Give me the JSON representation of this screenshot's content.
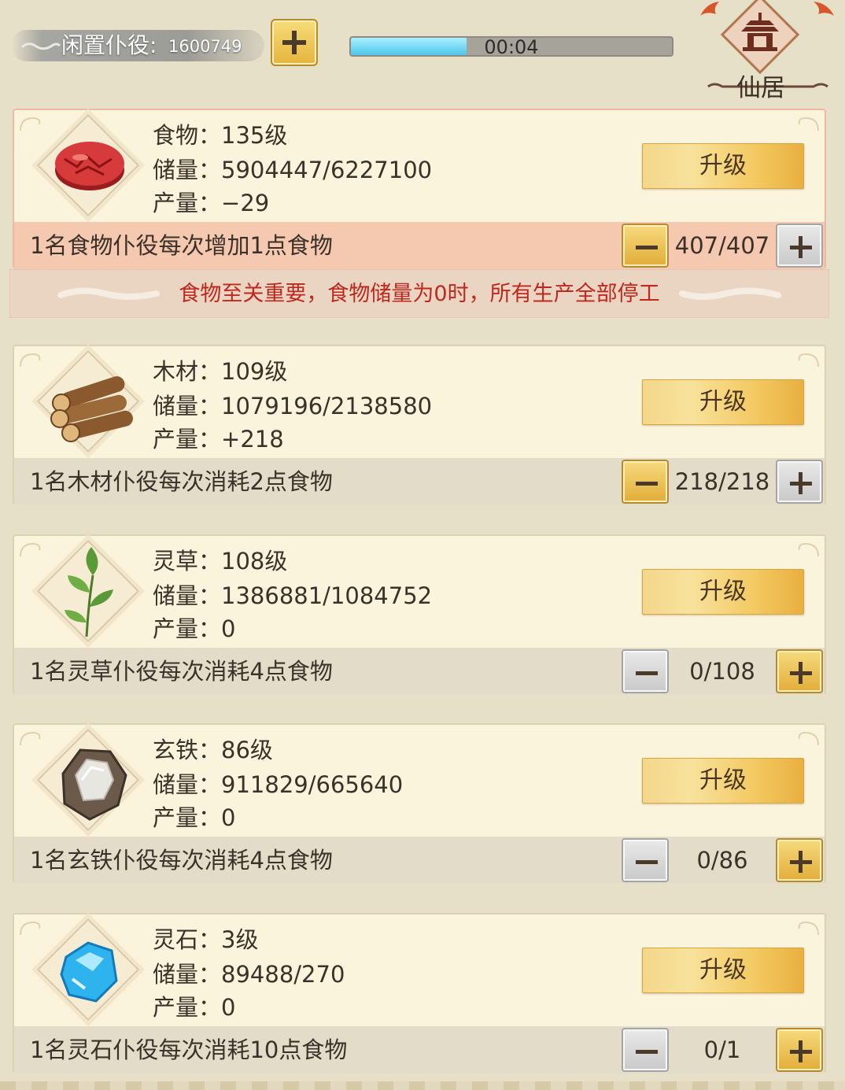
{
  "header": {
    "idle_label": "闲置仆役:",
    "idle_count": "1600749",
    "timer": "00:04",
    "timer_progress": 0.36,
    "home_label": "仙居"
  },
  "warning": "食物至关重要，食物储量为0时，所有生产全部停工",
  "colors": {
    "accent_gold": "#e6b43e",
    "warning_red": "#c0281e",
    "progress_blue": "#4fc6ea"
  },
  "resources": [
    {
      "icon": "meat-icon",
      "level_label": "食物：",
      "level": "135级",
      "storage_label": "储量：",
      "storage": "5904447/6227100",
      "output_label": "产量：",
      "output": "−29",
      "upgrade_label": "升级",
      "description": "1名食物仆役每次增加1点食物",
      "workers": "407/407",
      "minus_active": true,
      "plus_active": false
    },
    {
      "icon": "wood-logs-icon",
      "level_label": "木材：",
      "level": "109级",
      "storage_label": "储量：",
      "storage": "1079196/2138580",
      "output_label": "产量：",
      "output": "+218",
      "upgrade_label": "升级",
      "description": "1名木材仆役每次消耗2点食物",
      "workers": "218/218",
      "minus_active": true,
      "plus_active": false
    },
    {
      "icon": "herb-icon",
      "level_label": "灵草：",
      "level": "108级",
      "storage_label": "储量：",
      "storage": "1386881/1084752",
      "output_label": "产量：",
      "output": "0",
      "upgrade_label": "升级",
      "description": "1名灵草仆役每次消耗4点食物",
      "workers": "0/108",
      "minus_active": false,
      "plus_active": true
    },
    {
      "icon": "iron-ore-icon",
      "level_label": "玄铁：",
      "level": "86级",
      "storage_label": "储量：",
      "storage": "911829/665640",
      "output_label": "产量：",
      "output": "0",
      "upgrade_label": "升级",
      "description": "1名玄铁仆役每次消耗4点食物",
      "workers": "0/86",
      "minus_active": false,
      "plus_active": true
    },
    {
      "icon": "spirit-stone-icon",
      "level_label": "灵石：",
      "level": "3级",
      "storage_label": "储量：",
      "storage": "89488/270",
      "output_label": "产量：",
      "output": "0",
      "upgrade_label": "升级",
      "description": "1名灵石仆役每次消耗10点食物",
      "workers": "0/1",
      "minus_active": false,
      "plus_active": true
    }
  ]
}
